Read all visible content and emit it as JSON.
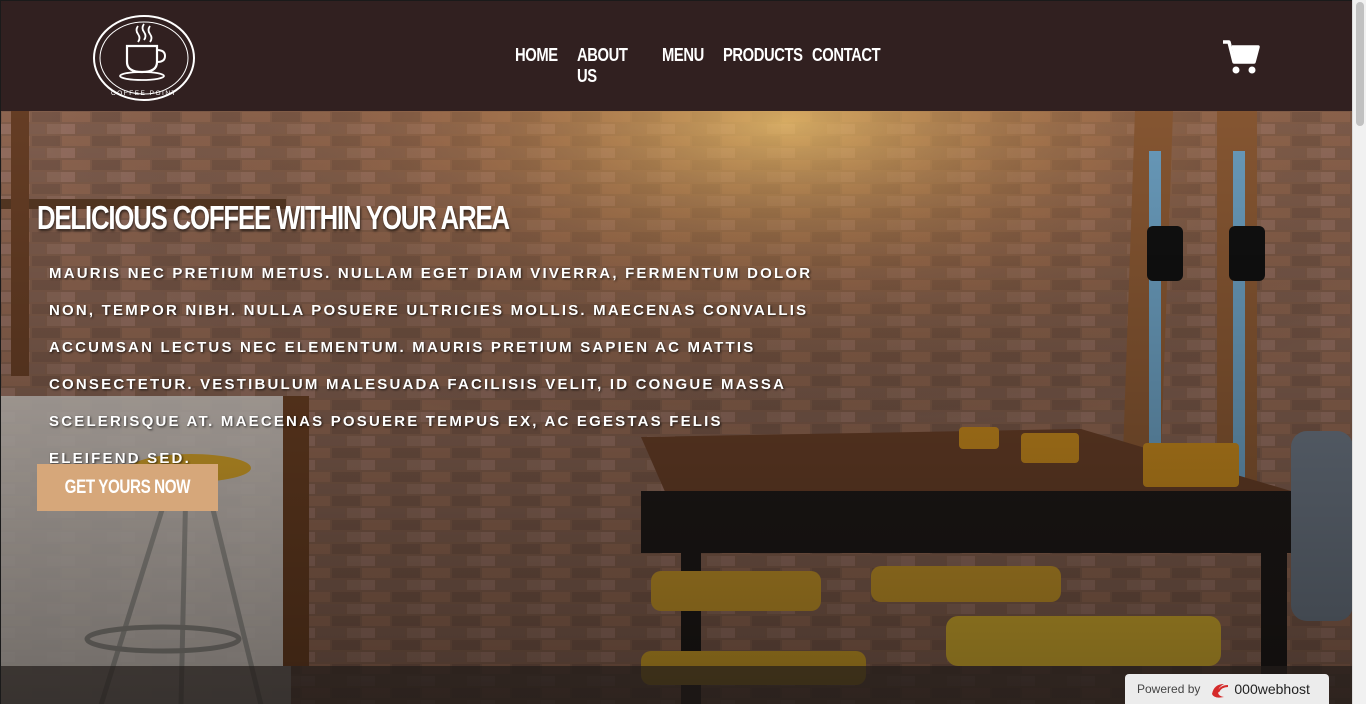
{
  "header": {
    "logo_text": "COFFEE POINT",
    "nav": [
      {
        "label": "HOME"
      },
      {
        "label": "ABOUT US"
      },
      {
        "label": "MENU"
      },
      {
        "label": "PRODUCTS"
      },
      {
        "label": "CONTACT"
      }
    ],
    "cart_icon": "shopping-cart-icon"
  },
  "hero": {
    "title": "DELICIOUS COFFEE WITHIN YOUR AREA",
    "body": "Mauris nec pretium metus. Nullam eget diam viverra, fermentum dolor non, tempor nibh. Nulla posuere ultricies mollis. Maecenas convallis accumsan lectus nec elementum. Mauris pretium sapien ac mattis consectetur. Vestibulum malesuada facilisis velit, id congue massa scelerisque at. Maecenas posuere tempus ex, ac egestas felis eleifend sed.",
    "cta_label": "GET YOURS NOW"
  },
  "badge": {
    "powered_label": "Powered by",
    "brand": "000webhost"
  },
  "colors": {
    "header_bg": "#312020",
    "cta_bg": "#d6a77a",
    "nav_text": "#ffffff"
  }
}
